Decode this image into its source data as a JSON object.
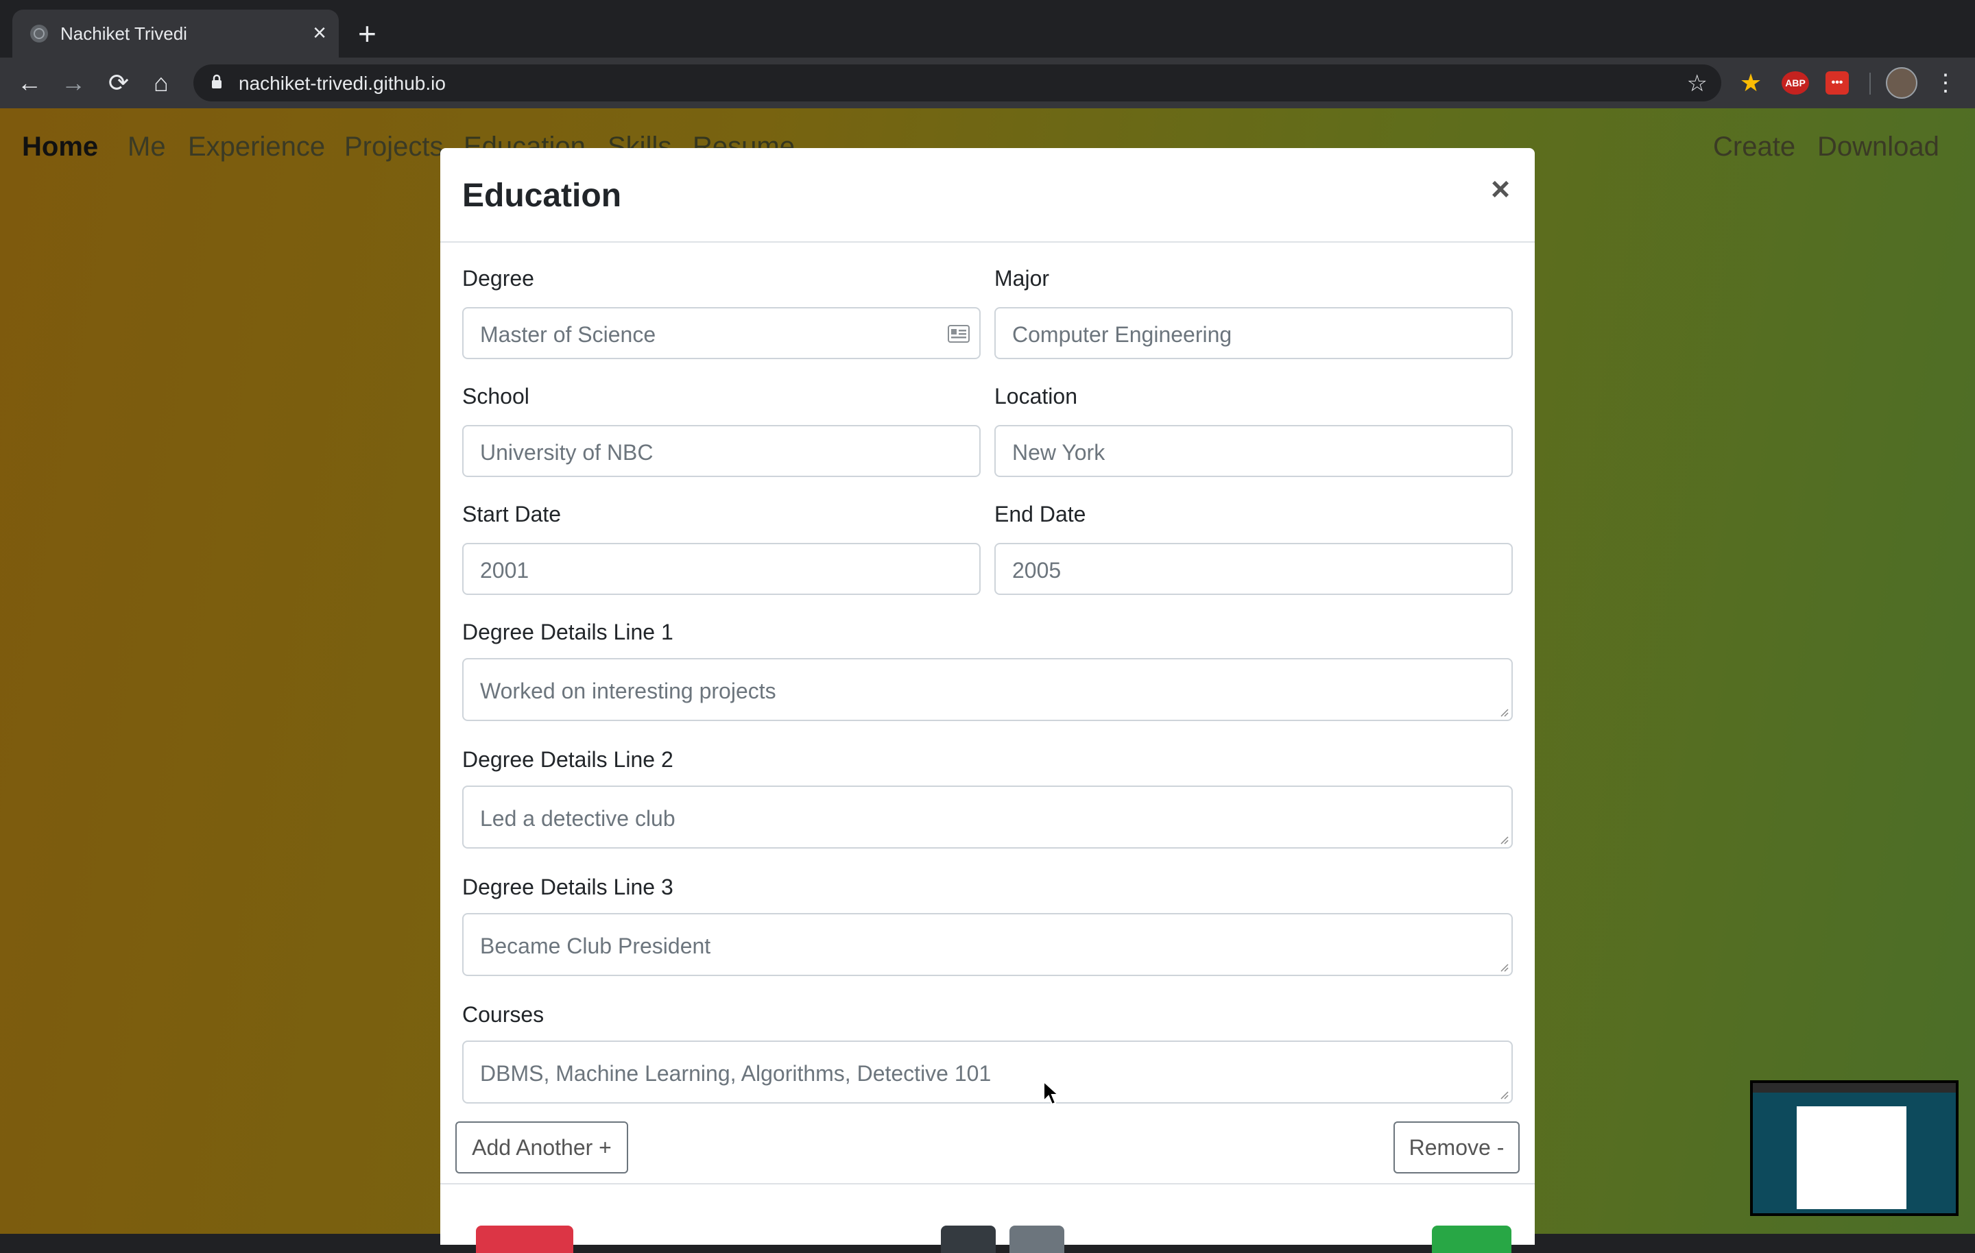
{
  "browser": {
    "tab_title": "Nachiket Trivedi",
    "url": "nachiket-trivedi.github.io",
    "extensions": [
      "ABP"
    ]
  },
  "site_nav": {
    "brand": "Home",
    "links": [
      "Me",
      "Experience",
      "Projects",
      "Education",
      "Skills",
      "Resume"
    ],
    "right_links": [
      "Create",
      "Download"
    ]
  },
  "modal": {
    "title": "Education",
    "fields": {
      "degree": {
        "label": "Degree",
        "placeholder": "Master of Science"
      },
      "major": {
        "label": "Major",
        "placeholder": "Computer Engineering"
      },
      "school": {
        "label": "School",
        "placeholder": "University of NBC"
      },
      "location": {
        "label": "Location",
        "placeholder": "New York"
      },
      "start_date": {
        "label": "Start Date",
        "placeholder": "2001"
      },
      "end_date": {
        "label": "End Date",
        "placeholder": "2005"
      },
      "details1": {
        "label": "Degree Details Line 1",
        "placeholder": "Worked on interesting projects"
      },
      "details2": {
        "label": "Degree Details Line 2",
        "placeholder": "Led a detective club"
      },
      "details3": {
        "label": "Degree Details Line 3",
        "placeholder": "Became Club President"
      },
      "courses": {
        "label": "Courses",
        "placeholder": "DBMS, Machine Learning, Algorithms, Detective 101"
      }
    },
    "add_button": "Add Another +",
    "remove_button": "Remove -"
  },
  "colors": {
    "danger": "#dc3545",
    "success": "#28a745",
    "dark": "#343a40",
    "secondary": "#6c757d"
  }
}
